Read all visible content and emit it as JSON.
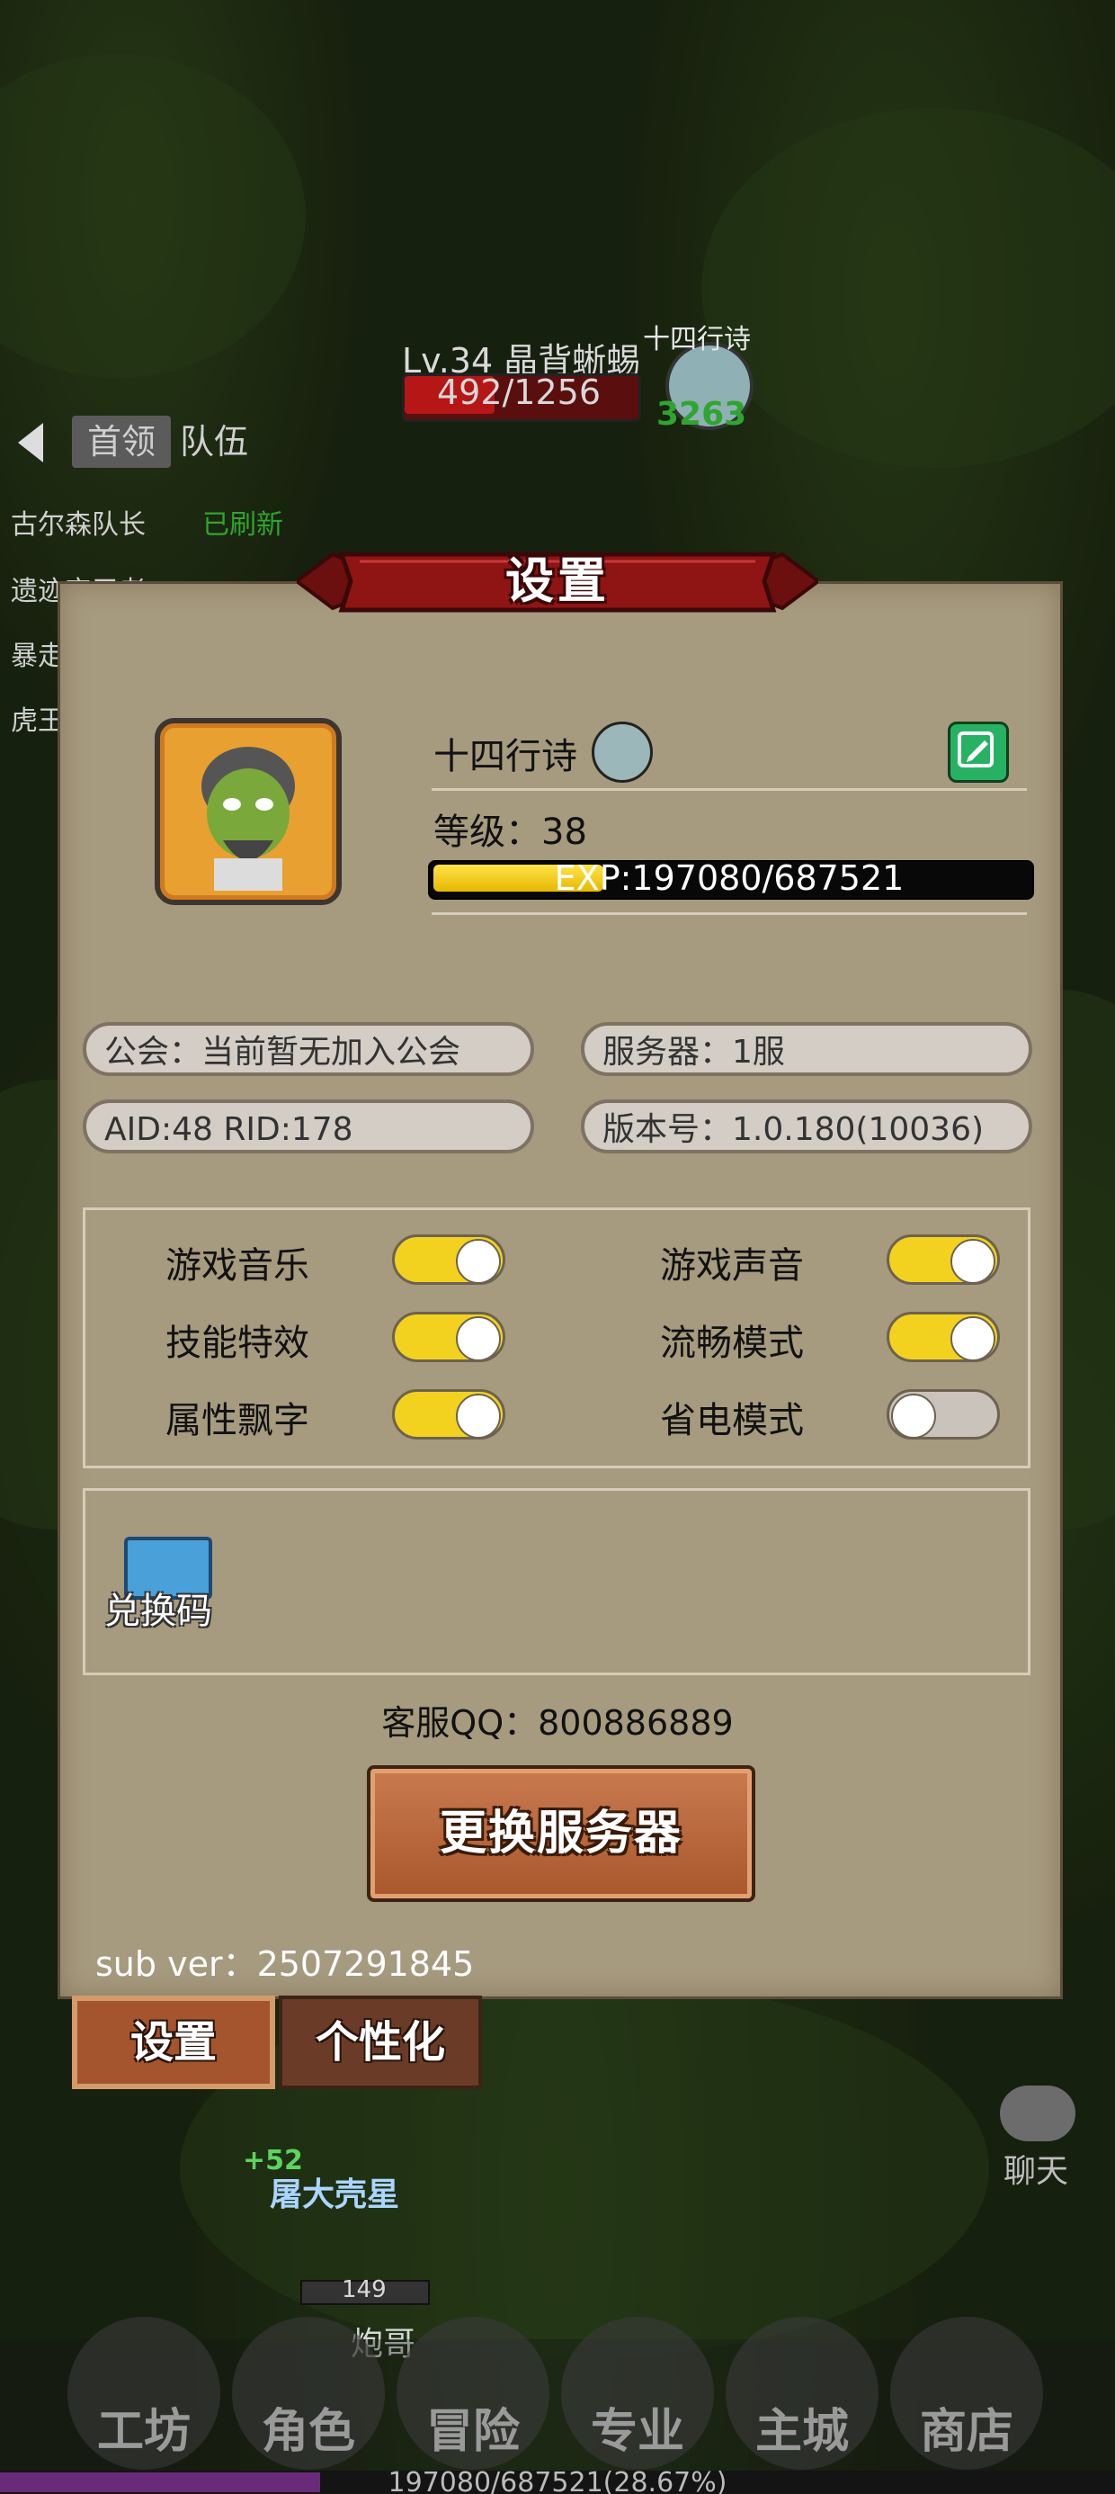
{
  "top_hud": {
    "monster_name": "Lv.34 晶背蜥蜴",
    "monster_hp": "492/1256",
    "player_name": "十四行诗",
    "player_number": "3263",
    "tabs": {
      "boss": "首领",
      "team": "队伍"
    },
    "side_list": [
      {
        "name": "古尔森队长",
        "status": "已刷新"
      },
      {
        "name": "遗迹守卫者",
        "status": ""
      },
      {
        "name": "暴走",
        "status": ""
      },
      {
        "name": "虎王",
        "status": ""
      }
    ]
  },
  "dialog": {
    "title": "设置",
    "player_name": "十四行诗",
    "level_label": "等级：38",
    "exp_label": "EXP:197080/687521",
    "exp_progress": 0.2867,
    "guild": "公会：当前暂无加入公会",
    "server": "服务器：1服",
    "ids": "AID:48  RID:178",
    "version": "版本号：1.0.180(10036)",
    "settings": [
      {
        "label": "游戏音乐",
        "on": true
      },
      {
        "label": "游戏声音",
        "on": true
      },
      {
        "label": "技能特效",
        "on": true
      },
      {
        "label": "流畅模式",
        "on": true
      },
      {
        "label": "属性飘字",
        "on": true
      },
      {
        "label": "省电模式",
        "on": false
      }
    ],
    "redeem_label": "兑换码",
    "support_qq": "客服QQ：800886889",
    "switch_server_label": "更换服务器",
    "sub_ver": "sub ver：2507291845"
  },
  "bottom_tabs": {
    "settings": "设置",
    "personalize": "个性化"
  },
  "chat_label": "聊天",
  "field": {
    "pet_level": "+52",
    "pet_name": "屠大壳星",
    "hero_hp": "149",
    "hero_name": "炮哥"
  },
  "nav": [
    "工坊",
    "角色",
    "冒险",
    "专业",
    "主城",
    "商店"
  ],
  "exp_bar_text": "197080/687521(28.67%)",
  "colors": {
    "panel": "#a69a7f",
    "toggle_on": "#f2d21f",
    "toggle_off": "#c9c3bb",
    "exp_fill": "#f2d21f",
    "edit_button": "#27b263",
    "banner_red": "#8f1414"
  }
}
